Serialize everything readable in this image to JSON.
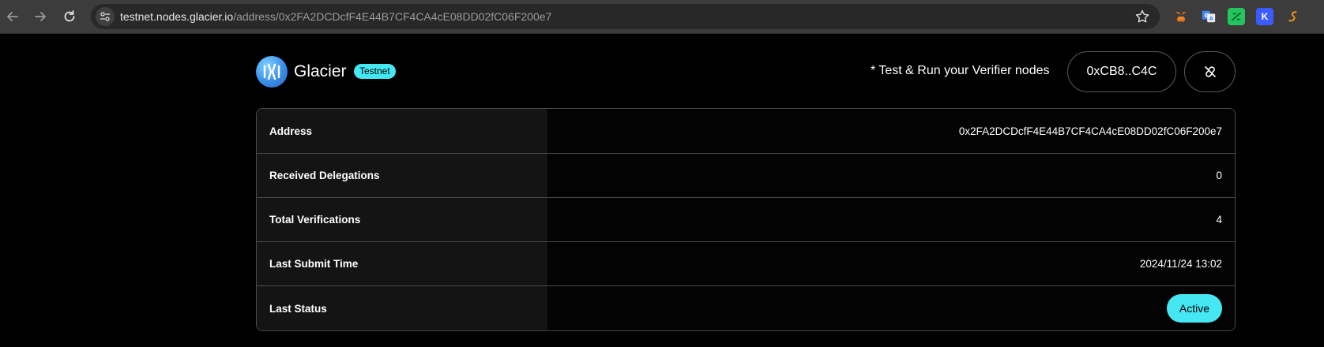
{
  "browser": {
    "url_host": "testnet.nodes.glacier.io",
    "url_path": "/address/0x2FA2DCDcfF4E44B7CF4CA4cE08DD02fC06F200e7",
    "icons": [
      "back-arrow-icon",
      "forward-arrow-icon",
      "reload-icon",
      "site-info-icon",
      "bookmark-star-icon"
    ],
    "extensions": [
      "metamask-fox-extension",
      "translate-extension",
      "green-extension",
      "k-extension",
      "orange-s-extension"
    ]
  },
  "header": {
    "brand_name": "Glacier",
    "network_badge": "Testnet",
    "verifier_link": "* Test & Run your Verifier nodes",
    "wallet_button": "0xCB8..C4C",
    "disconnect_icon": "broken-link-icon"
  },
  "details": {
    "rows": [
      {
        "label": "Address",
        "value": "0x2FA2DCDcfF4E44B7CF4CA4cE08DD02fC06F200e7"
      },
      {
        "label": "Received Delegations",
        "value": "0"
      },
      {
        "label": "Total Verifications",
        "value": "4"
      },
      {
        "label": "Last Submit Time",
        "value": "2024/11/24 13:02"
      },
      {
        "label": "Last Status",
        "value": "Active"
      }
    ]
  },
  "colors": {
    "accent": "#45e8f2",
    "background": "#000000",
    "chrome": "#3c3c3c"
  }
}
